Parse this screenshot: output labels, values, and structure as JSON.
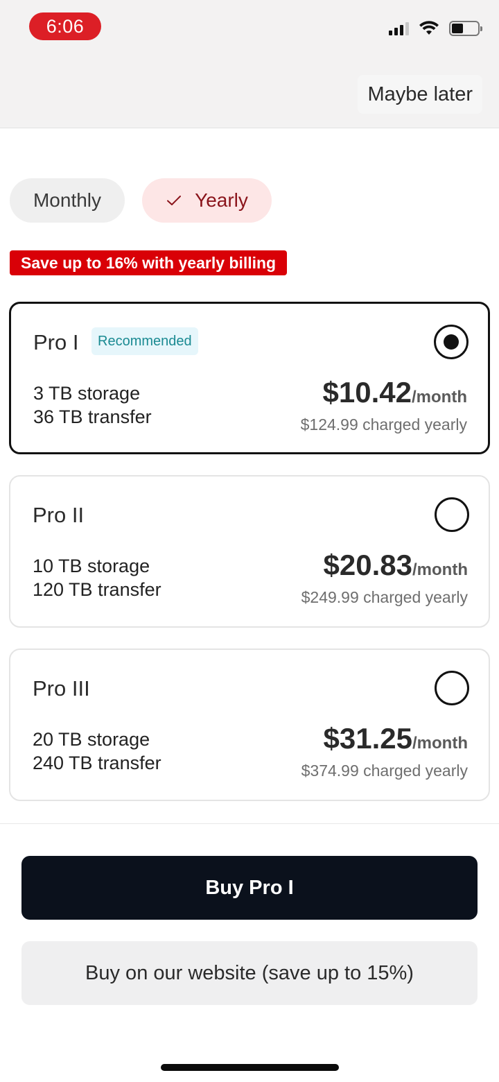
{
  "status_bar": {
    "time": "6:06",
    "icons": [
      "signal-icon",
      "wifi-icon",
      "battery-icon"
    ],
    "battery_level": 0.45
  },
  "header": {
    "dismiss_label": "Maybe later"
  },
  "billing_toggle": {
    "monthly_label": "Monthly",
    "yearly_label": "Yearly",
    "selected": "Yearly"
  },
  "promo_banner": "Save up to 16% with yearly billing",
  "plans": [
    {
      "name": "Pro I",
      "badge": "Recommended",
      "selected": true,
      "storage": "3 TB storage",
      "transfer": "36 TB transfer",
      "price": "$10.42",
      "per": "/month",
      "charged": "$124.99 charged yearly"
    },
    {
      "name": "Pro II",
      "selected": false,
      "storage": "10 TB storage",
      "transfer": "120 TB transfer",
      "price": "$20.83",
      "per": "/month",
      "charged": "$249.99 charged yearly"
    },
    {
      "name": "Pro III",
      "selected": false,
      "storage": "20 TB storage",
      "transfer": "240 TB transfer",
      "price": "$31.25",
      "per": "/month",
      "charged": "$374.99 charged yearly"
    }
  ],
  "actions": {
    "buy_label": "Buy Pro I",
    "website_label": "Buy on our website (save up to 15%)"
  },
  "colors": {
    "accent_red": "#d90007",
    "selected_border": "#111111",
    "buy_button": "#0b111c",
    "recommended_badge": "#1a8a92"
  }
}
